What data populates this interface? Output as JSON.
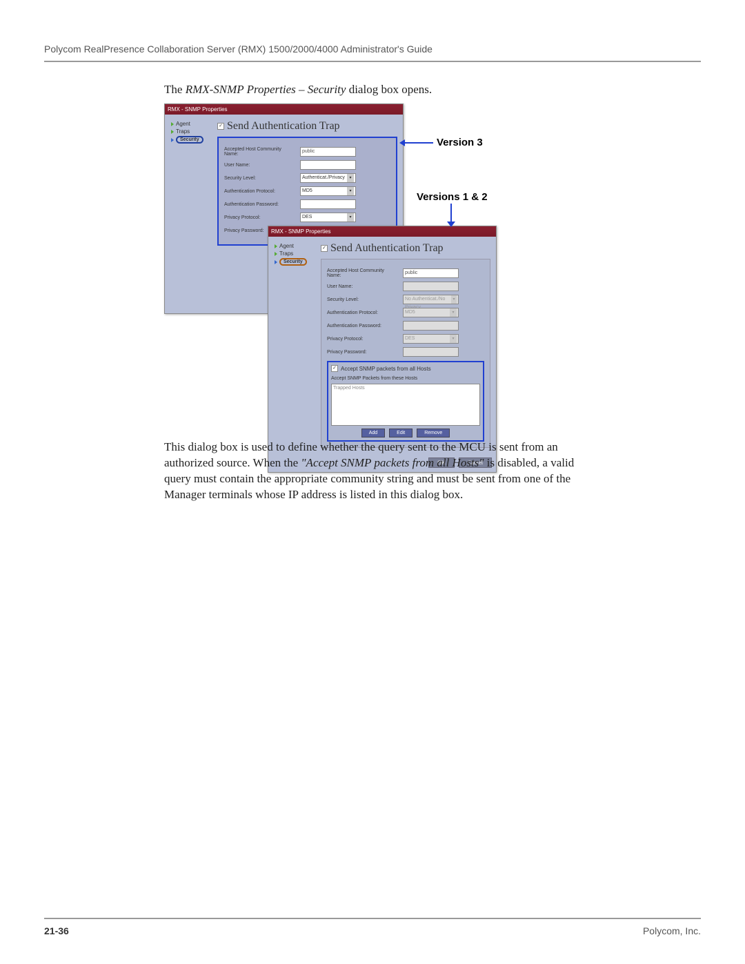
{
  "header": "Polycom RealPresence Collaboration Server (RMX) 1500/2000/4000 Administrator's Guide",
  "intro": {
    "pre": "The ",
    "ital": "RMX-SNMP Properties – Security",
    "post": " dialog box opens."
  },
  "callouts": {
    "v3": "Version 3",
    "v12": "Versions 1 & 2"
  },
  "dlg1": {
    "title": "RMX - SNMP Properties",
    "nav": [
      "Agent",
      "Traps",
      "Security"
    ],
    "chk": "Send Authentication Trap",
    "fields": {
      "community": {
        "lbl": "Accepted Host Community Name:",
        "val": "public"
      },
      "user": {
        "lbl": "User Name:"
      },
      "seclevel": {
        "lbl": "Security Level:",
        "val": "Authenticat./Privacy"
      },
      "authproto": {
        "lbl": "Authentication Protocol:",
        "val": "MD5"
      },
      "authpass": {
        "lbl": "Authentication Password:"
      },
      "privproto": {
        "lbl": "Privacy Protocol:",
        "val": "DES"
      },
      "privpass": {
        "lbl": "Privacy Password:"
      }
    }
  },
  "dlg2": {
    "title": "RMX - SNMP Properties",
    "nav": [
      "Agent",
      "Traps",
      "Security"
    ],
    "chk": "Send Authentication Trap",
    "fields": {
      "community": {
        "lbl": "Accepted Host Community Name:",
        "val": "public"
      },
      "user": {
        "lbl": "User Name:"
      },
      "seclevel": {
        "lbl": "Security Level:",
        "val": "No Authenticat./No Privacy"
      },
      "authproto": {
        "lbl": "Authentication Protocol:",
        "val": "MD5"
      },
      "authpass": {
        "lbl": "Authentication Password:"
      },
      "privproto": {
        "lbl": "Privacy Protocol:",
        "val": "DES"
      },
      "privpass": {
        "lbl": "Privacy Password:"
      }
    },
    "hosts": {
      "chk": "Accept SNMP packets from all Hosts",
      "sub": "Accept SNMP Packets from these Hosts",
      "col": "Trapped Hosts"
    },
    "btns": {
      "add": "Add",
      "edit": "Edit",
      "remove": "Remove"
    },
    "footer": {
      "ok": "OK",
      "cancel": "Cancel"
    }
  },
  "body": {
    "p1a": "This dialog box is used to define whether the query sent to the MCU is sent from an authorized source. When the ",
    "p1i": "\"Accept SNMP packets from all Hosts\"",
    "p1b": " is disabled, a valid query must contain the appropriate community string and must be sent from one of the Manager terminals whose IP address is listed in this dialog box."
  },
  "footer": {
    "page": "21-36",
    "co": "Polycom, Inc."
  }
}
